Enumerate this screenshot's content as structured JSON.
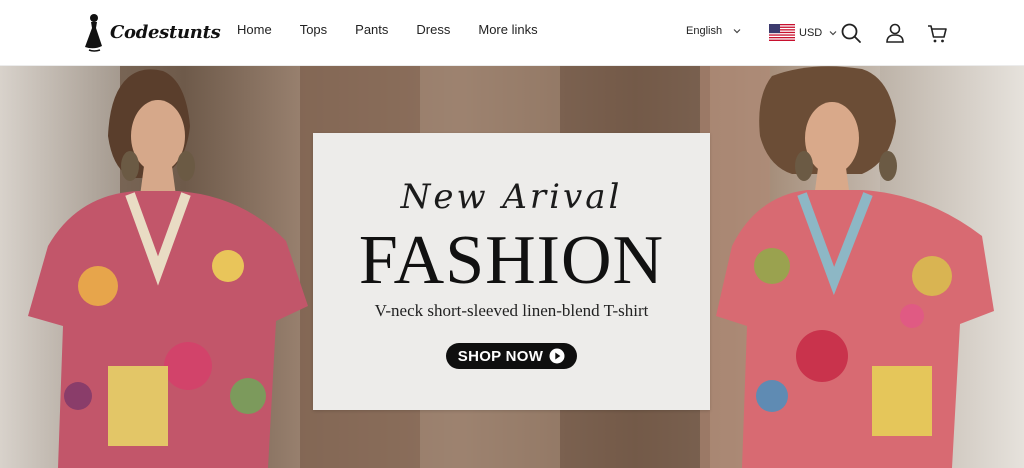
{
  "brand": {
    "name": "Codestunts",
    "logo_icon": "dress-figure-logo"
  },
  "nav": {
    "items": [
      {
        "label": "Home"
      },
      {
        "label": "Tops"
      },
      {
        "label": "Pants"
      },
      {
        "label": "Dress"
      },
      {
        "label": "More links"
      }
    ]
  },
  "header": {
    "language": "English",
    "currency": "USD",
    "currency_flag": "us-flag-icon",
    "icons": [
      "search-icon",
      "user-icon",
      "cart-icon"
    ]
  },
  "hero": {
    "script_heading": "New Arival",
    "title": "FASHION",
    "subtitle": "V-neck short-sleeved linen-blend T-shirt",
    "cta_label": "SHOP NOW",
    "cta_icon": "play-circle-icon"
  },
  "colors": {
    "header_bg": "#ffffff",
    "cta_bg": "#0f0f0f",
    "card_bg": "#f1f0ee",
    "text": "#222222"
  }
}
